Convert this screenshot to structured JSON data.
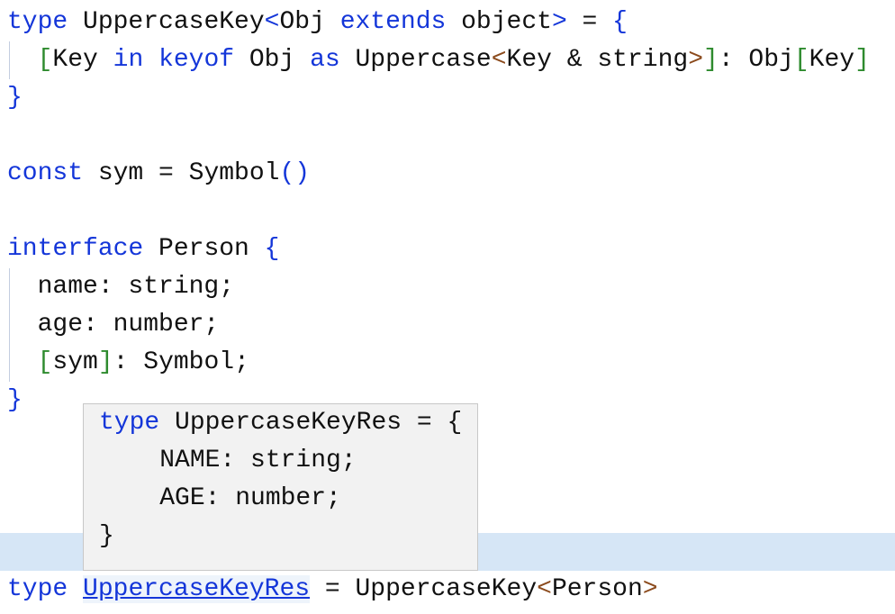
{
  "colors": {
    "keyword": "#1436d9",
    "bracket": "#2e8b2e",
    "angle": "#8b4a1c",
    "current_line": "#d6e6f6",
    "tooltip_bg": "#f2f2f2"
  },
  "editor": {
    "lines": [
      [
        [
          "kw",
          "type"
        ],
        [
          "pl",
          " UppercaseKey"
        ],
        [
          "kw",
          "<"
        ],
        [
          "pl",
          "Obj "
        ],
        [
          "kw",
          "extends"
        ],
        [
          "pl",
          " object"
        ],
        [
          "kw",
          ">"
        ],
        [
          "pl",
          " = "
        ],
        [
          "kw",
          "{"
        ]
      ],
      [
        [
          "pl",
          "  "
        ],
        [
          "br",
          "["
        ],
        [
          "pl",
          "Key "
        ],
        [
          "kw",
          "in"
        ],
        [
          "pl",
          " "
        ],
        [
          "kw",
          "keyof"
        ],
        [
          "pl",
          " Obj "
        ],
        [
          "kw",
          "as"
        ],
        [
          "pl",
          " Uppercase"
        ],
        [
          "ang",
          "<"
        ],
        [
          "pl",
          "Key & string"
        ],
        [
          "ang",
          ">"
        ],
        [
          "br",
          "]"
        ],
        [
          "pl",
          ": Obj"
        ],
        [
          "br",
          "["
        ],
        [
          "pl",
          "Key"
        ],
        [
          "br",
          "]"
        ]
      ],
      [
        [
          "kw",
          "}"
        ]
      ],
      [],
      [
        [
          "kw",
          "const"
        ],
        [
          "pl",
          " sym = Symbol"
        ],
        [
          "kw",
          "()"
        ]
      ],
      [],
      [
        [
          "kw",
          "interface"
        ],
        [
          "pl",
          " Person "
        ],
        [
          "kw",
          "{"
        ]
      ],
      [
        [
          "pl",
          "  name: string;"
        ]
      ],
      [
        [
          "pl",
          "  age: number;"
        ]
      ],
      [
        [
          "pl",
          "  "
        ],
        [
          "br",
          "["
        ],
        [
          "pl",
          "sym"
        ],
        [
          "br",
          "]"
        ],
        [
          "pl",
          ": Symbol;"
        ]
      ],
      [
        [
          "kw",
          "}"
        ]
      ],
      [],
      [],
      [],
      [],
      [
        [
          "kw",
          "type"
        ],
        [
          "pl",
          " "
        ],
        [
          "link",
          "UppercaseKeyRes"
        ],
        [
          "pl",
          " = UppercaseKey"
        ],
        [
          "ang",
          "<"
        ],
        [
          "pl",
          "Person"
        ],
        [
          "ang",
          ">"
        ]
      ]
    ]
  },
  "tooltip": {
    "lines": [
      [
        [
          "kw",
          "type"
        ],
        [
          "pl",
          " UppercaseKeyRes = {"
        ]
      ],
      [
        [
          "pl",
          "    NAME: string;"
        ]
      ],
      [
        [
          "pl",
          "    AGE: number;"
        ]
      ],
      [
        [
          "pl",
          "}"
        ]
      ]
    ]
  }
}
